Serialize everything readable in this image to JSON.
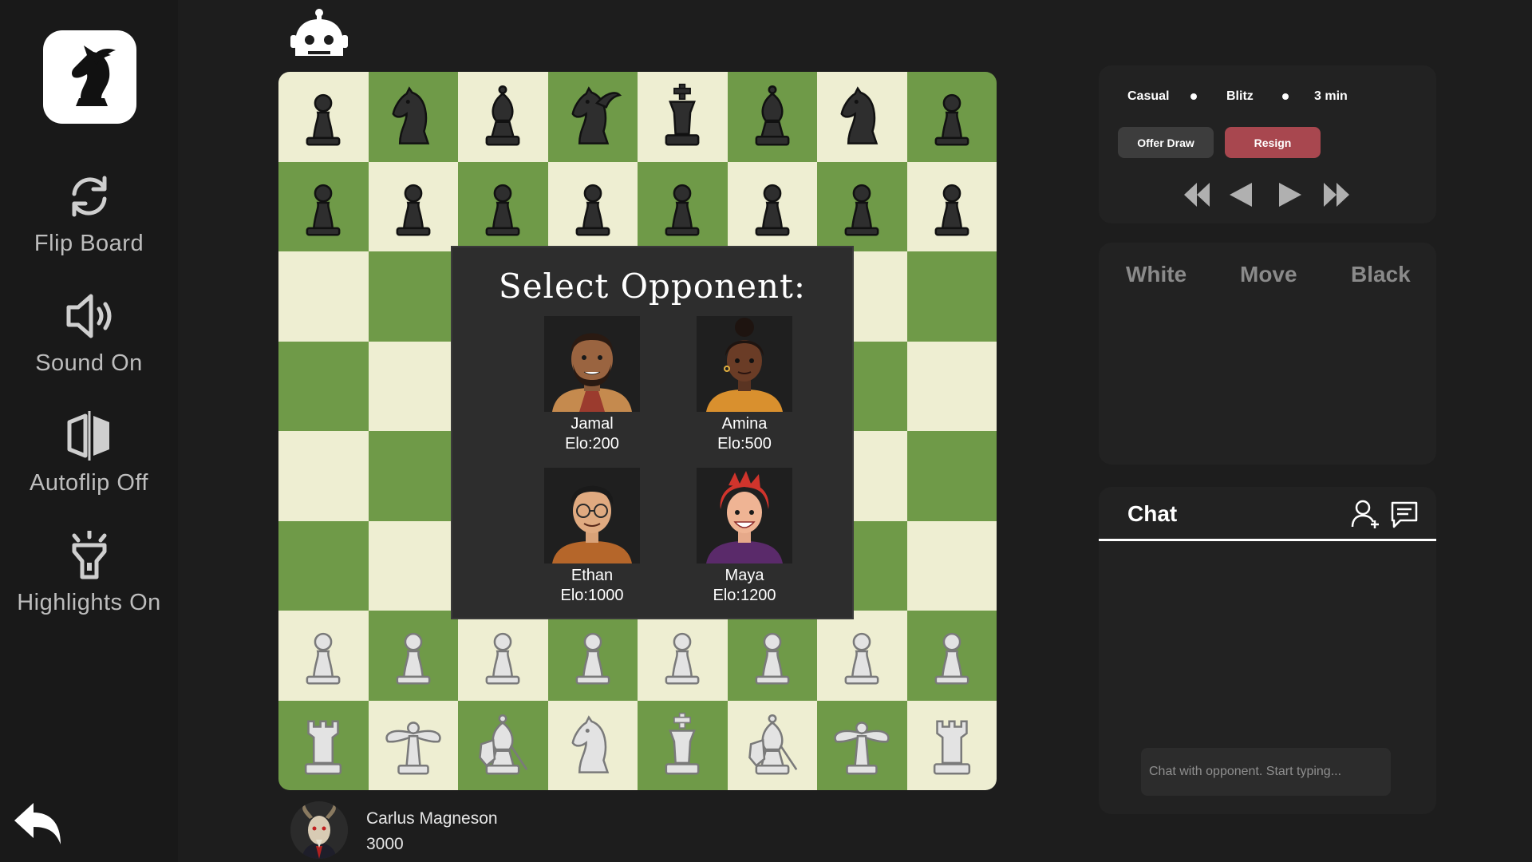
{
  "sidebar": {
    "items": [
      {
        "label": "Flip Board",
        "icon": "flip-icon"
      },
      {
        "label": "Sound On",
        "icon": "speaker-icon"
      },
      {
        "label": "Autoflip Off",
        "icon": "autoflip-icon"
      },
      {
        "label": "Highlights On",
        "icon": "flashlight-icon"
      }
    ],
    "logo_icon": "knight-logo-icon",
    "back_icon": "back-arrow-icon"
  },
  "board": {
    "light_color": "#eeeed2",
    "dark_color": "#6f9a48",
    "black_back_rank": [
      "pawn",
      "knight",
      "bishop",
      "pegasus",
      "king",
      "bishop",
      "knight",
      "pawn"
    ],
    "white_back_rank": [
      "rook",
      "dragonfly",
      "bishop-shield",
      "knight",
      "king",
      "bishop-shield",
      "dragonfly",
      "rook"
    ]
  },
  "opponent_select": {
    "title": "Select Opponent:",
    "opponents": [
      {
        "name": "Jamal",
        "elo": "Elo:200"
      },
      {
        "name": "Amina",
        "elo": "Elo:500"
      },
      {
        "name": "Ethan",
        "elo": "Elo:1000"
      },
      {
        "name": "Maya",
        "elo": "Elo:1200"
      }
    ]
  },
  "player": {
    "name": "Carlus Magneson",
    "rating": "3000"
  },
  "game": {
    "mode": "Casual",
    "type": "Blitz",
    "time": "3 min",
    "offer_draw": "Offer Draw",
    "resign": "Resign",
    "resign_color": "#a8474f"
  },
  "moves": {
    "headers": [
      "White",
      "Move",
      "Black"
    ]
  },
  "chat": {
    "title": "Chat",
    "placeholder": "Chat with opponent. Start typing..."
  }
}
